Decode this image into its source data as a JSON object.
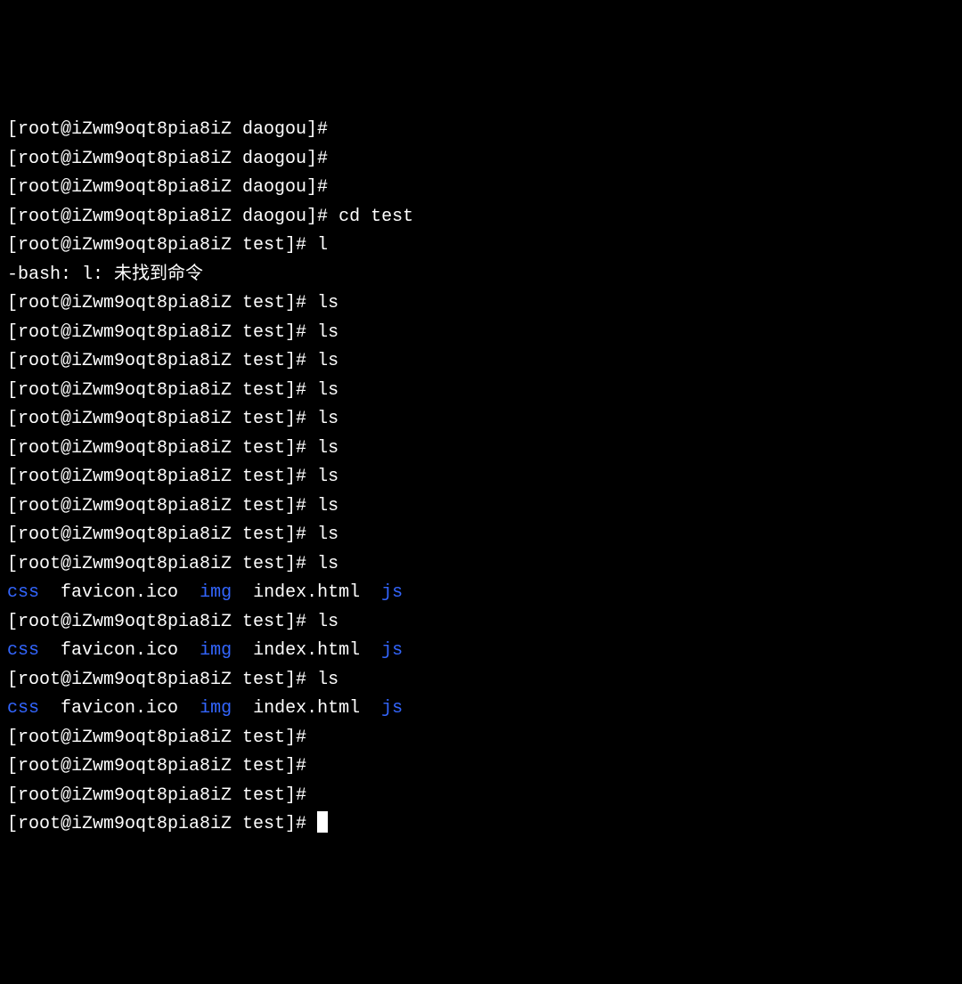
{
  "hostname": "iZwm9oqt8pia8iZ",
  "user": "root",
  "dirs": {
    "daogou": "daogou",
    "test": "test"
  },
  "lines": [
    {
      "type": "prompt",
      "dir": "daogou",
      "cmd": ""
    },
    {
      "type": "prompt",
      "dir": "daogou",
      "cmd": ""
    },
    {
      "type": "prompt",
      "dir": "daogou",
      "cmd": ""
    },
    {
      "type": "prompt",
      "dir": "daogou",
      "cmd": "cd test"
    },
    {
      "type": "prompt",
      "dir": "test",
      "cmd": "l"
    },
    {
      "type": "error",
      "text": "-bash: l: 未找到命令"
    },
    {
      "type": "prompt",
      "dir": "test",
      "cmd": "ls"
    },
    {
      "type": "prompt",
      "dir": "test",
      "cmd": "ls"
    },
    {
      "type": "prompt",
      "dir": "test",
      "cmd": "ls"
    },
    {
      "type": "prompt",
      "dir": "test",
      "cmd": "ls"
    },
    {
      "type": "prompt",
      "dir": "test",
      "cmd": "ls"
    },
    {
      "type": "prompt",
      "dir": "test",
      "cmd": "ls"
    },
    {
      "type": "prompt",
      "dir": "test",
      "cmd": "ls"
    },
    {
      "type": "prompt",
      "dir": "test",
      "cmd": "ls"
    },
    {
      "type": "prompt",
      "dir": "test",
      "cmd": "ls"
    },
    {
      "type": "prompt",
      "dir": "test",
      "cmd": "ls"
    },
    {
      "type": "listing"
    },
    {
      "type": "prompt",
      "dir": "test",
      "cmd": "ls"
    },
    {
      "type": "listing"
    },
    {
      "type": "prompt",
      "dir": "test",
      "cmd": "ls"
    },
    {
      "type": "listing"
    },
    {
      "type": "prompt",
      "dir": "test",
      "cmd": ""
    },
    {
      "type": "prompt",
      "dir": "test",
      "cmd": ""
    },
    {
      "type": "prompt",
      "dir": "test",
      "cmd": ""
    },
    {
      "type": "prompt_cursor",
      "dir": "test",
      "cmd": ""
    }
  ],
  "listing": {
    "items": [
      {
        "name": "css",
        "kind": "dir"
      },
      {
        "name": "favicon.ico",
        "kind": "file"
      },
      {
        "name": "img",
        "kind": "dir"
      },
      {
        "name": "index.html",
        "kind": "file"
      },
      {
        "name": "js",
        "kind": "dir"
      }
    ]
  },
  "prompt_template": {
    "open": "[",
    "at": "@",
    "sep": " ",
    "close": "]# "
  }
}
